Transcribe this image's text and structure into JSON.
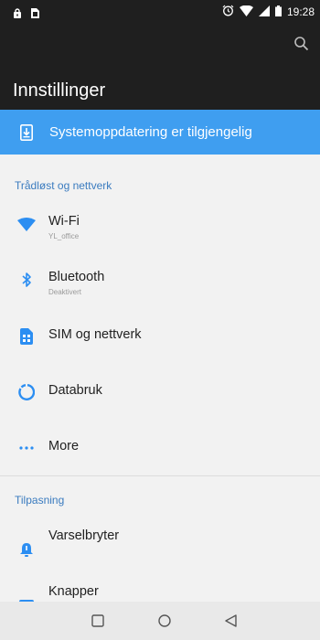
{
  "status_bar": {
    "time": "19:28",
    "icons": [
      "lock-icon",
      "sim-card-icon",
      "alarm-icon",
      "wifi-icon",
      "signal-icon",
      "battery-icon"
    ]
  },
  "app_bar": {
    "title": "Innstillinger",
    "search_icon": "search-icon"
  },
  "banner": {
    "text": "Systemoppdatering er tilgjengelig",
    "icon": "system-update-icon",
    "color": "#3f9ef0"
  },
  "sections": [
    {
      "header": "Trådløst og nettverk",
      "items": [
        {
          "title": "Wi-Fi",
          "subtitle": "YL_office",
          "icon": "wifi-icon"
        },
        {
          "title": "Bluetooth",
          "subtitle": "Deaktivert",
          "icon": "bluetooth-icon"
        },
        {
          "title": "SIM og nettverk",
          "subtitle": "",
          "icon": "sim-card-icon"
        },
        {
          "title": "Databruk",
          "subtitle": "",
          "icon": "data-usage-icon"
        },
        {
          "title": "More",
          "subtitle": "",
          "icon": "more-dots-icon"
        }
      ]
    },
    {
      "header": "Tilpasning",
      "items": [
        {
          "title": "Varselbryter",
          "subtitle": "",
          "icon": "notification-bell-icon"
        },
        {
          "title": "Knapper",
          "subtitle": "",
          "icon": "buttons-icon"
        }
      ]
    }
  ],
  "colors": {
    "dark_bar": "#1f1f1f",
    "accent": "#3f9ef0",
    "section_header": "#3a7bbf",
    "icon_blue": "#2c8ef2"
  },
  "nav_bar": {
    "icons": [
      "recent-apps-icon",
      "home-icon",
      "back-icon"
    ]
  }
}
